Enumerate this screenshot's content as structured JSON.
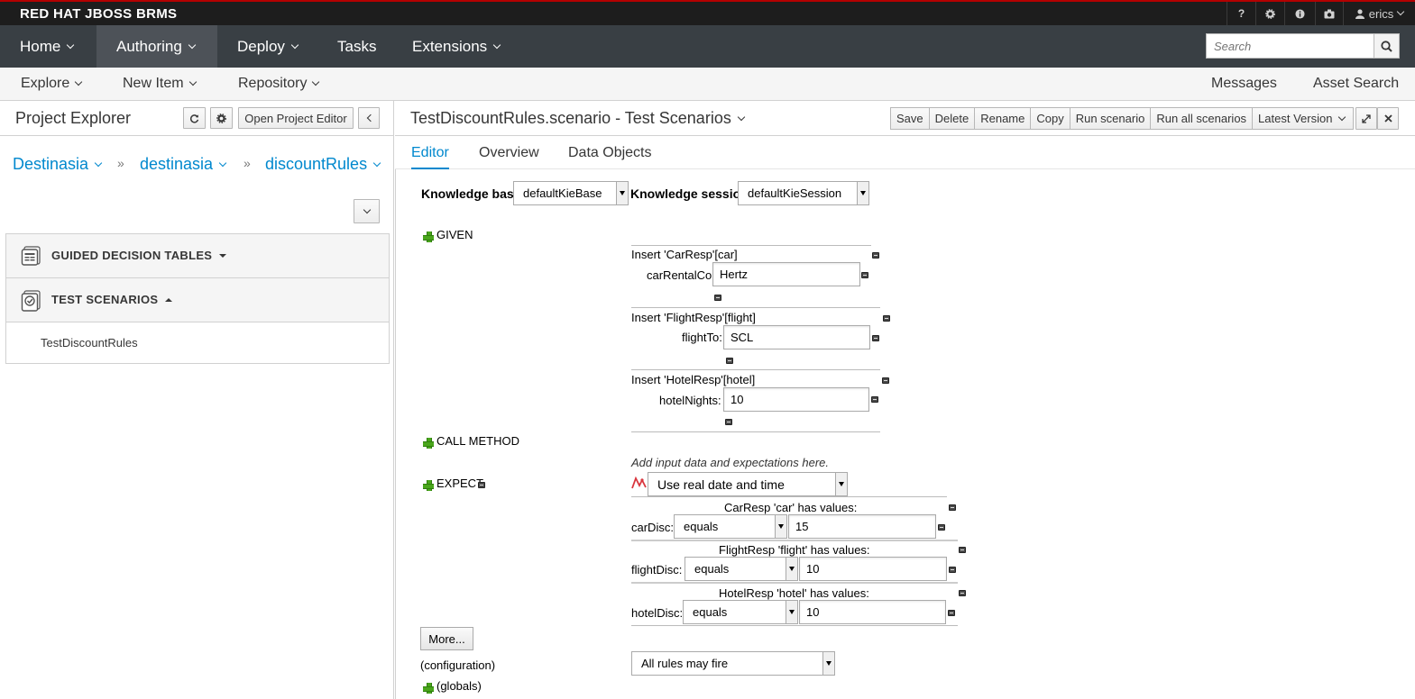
{
  "brand": {
    "title": "RED HAT JBOSS BRMS"
  },
  "utility_bar": {
    "help": "?",
    "user": "erics"
  },
  "main_nav": {
    "items": [
      {
        "label": "Home"
      },
      {
        "label": "Authoring"
      },
      {
        "label": "Deploy"
      },
      {
        "label": "Tasks"
      },
      {
        "label": "Extensions"
      }
    ],
    "search_placeholder": "Search"
  },
  "sub_nav": {
    "items": [
      {
        "label": "Explore"
      },
      {
        "label": "New Item"
      },
      {
        "label": "Repository"
      }
    ],
    "right_items": [
      {
        "label": "Messages"
      },
      {
        "label": "Asset Search"
      }
    ]
  },
  "project_explorer": {
    "title": "Project Explorer",
    "open_editor_label": "Open Project Editor",
    "breadcrumb": [
      {
        "label": "Destinasia"
      },
      {
        "label": "destinasia"
      },
      {
        "label": "discountRules"
      }
    ],
    "breadcrumb_sep": "»",
    "sections": [
      {
        "label": "GUIDED DECISION TABLES"
      },
      {
        "label": "TEST SCENARIOS"
      }
    ],
    "test_scenarios_items": [
      {
        "label": "TestDiscountRules"
      }
    ]
  },
  "editor": {
    "title": "TestDiscountRules.scenario - Test Scenarios",
    "toolbar": [
      {
        "label": "Save"
      },
      {
        "label": "Delete"
      },
      {
        "label": "Rename"
      },
      {
        "label": "Copy"
      },
      {
        "label": "Run scenario"
      },
      {
        "label": "Run all scenarios"
      },
      {
        "label": "Latest Version"
      }
    ],
    "tabs": [
      {
        "label": "Editor"
      },
      {
        "label": "Overview"
      },
      {
        "label": "Data Objects"
      }
    ],
    "knowledge_base_label": "Knowledge base",
    "knowledge_base_value": "defaultKieBase",
    "knowledge_session_label": "Knowledge session",
    "knowledge_session_value": "defaultKieSession",
    "given_label": "GIVEN",
    "given": [
      {
        "insert": "Insert 'CarResp'[car]",
        "field": "carRentalCo:",
        "value": "Hertz"
      },
      {
        "insert": "Insert 'FlightResp'[flight]",
        "field": "flightTo:",
        "value": "SCL"
      },
      {
        "insert": "Insert 'HotelResp'[hotel]",
        "field": "hotelNights:",
        "value": "10"
      }
    ],
    "call_method_label": "CALL METHOD",
    "hint": "Add input data and expectations here.",
    "expect_label": "EXPECT",
    "date_option": "Use real date and time",
    "expect": [
      {
        "header": "CarResp 'car' has values:",
        "field": "carDisc:",
        "op": "equals",
        "value": "15"
      },
      {
        "header": "FlightResp 'flight' has values:",
        "field": "flightDisc:",
        "op": "equals",
        "value": "10"
      },
      {
        "header": "HotelResp 'hotel' has values:",
        "field": "hotelDisc:",
        "op": "equals",
        "value": "10"
      }
    ],
    "more_label": "More...",
    "configuration_label": "(configuration)",
    "configuration_value": "All rules may fire",
    "globals_label": "(globals)"
  },
  "colors": {
    "accent": "#0088ce",
    "nav_bg": "#393f44",
    "brand_bg": "#1d1d1d"
  }
}
